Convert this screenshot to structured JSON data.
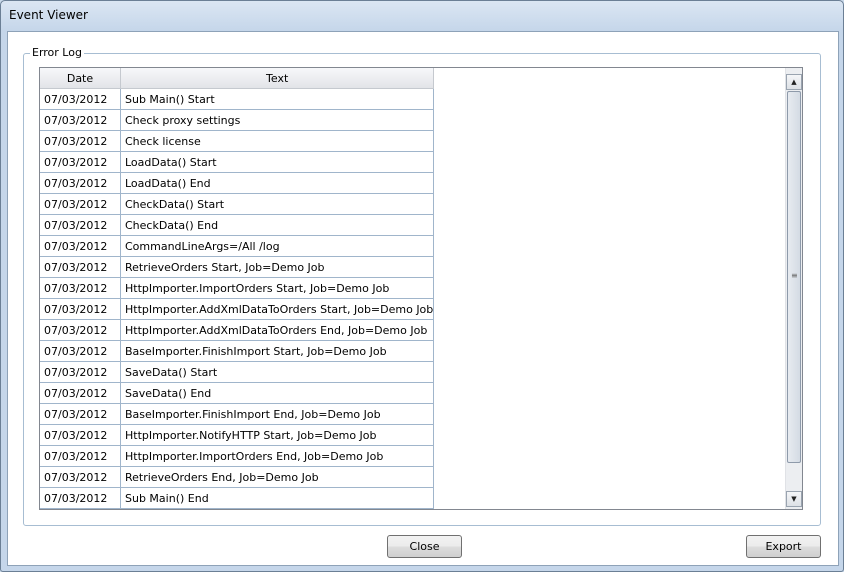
{
  "window": {
    "title": "Event Viewer"
  },
  "group": {
    "legend": "Error Log"
  },
  "table": {
    "columns": [
      "Date",
      "Text"
    ],
    "rows": [
      {
        "date": "07/03/2012",
        "text": "Sub Main() Start"
      },
      {
        "date": "07/03/2012",
        "text": "Check proxy settings"
      },
      {
        "date": "07/03/2012",
        "text": "Check license"
      },
      {
        "date": "07/03/2012",
        "text": "LoadData() Start"
      },
      {
        "date": "07/03/2012",
        "text": "LoadData() End"
      },
      {
        "date": "07/03/2012",
        "text": "CheckData() Start"
      },
      {
        "date": "07/03/2012",
        "text": "CheckData() End"
      },
      {
        "date": "07/03/2012",
        "text": "CommandLineArgs=/All /log"
      },
      {
        "date": "07/03/2012",
        "text": "RetrieveOrders Start, Job=Demo Job"
      },
      {
        "date": "07/03/2012",
        "text": "HttpImporter.ImportOrders Start, Job=Demo Job"
      },
      {
        "date": "07/03/2012",
        "text": "HttpImporter.AddXmlDataToOrders Start, Job=Demo Job"
      },
      {
        "date": "07/03/2012",
        "text": "HttpImporter.AddXmlDataToOrders End, Job=Demo Job"
      },
      {
        "date": "07/03/2012",
        "text": "BaseImporter.FinishImport Start, Job=Demo Job"
      },
      {
        "date": "07/03/2012",
        "text": "SaveData() Start"
      },
      {
        "date": "07/03/2012",
        "text": "SaveData() End"
      },
      {
        "date": "07/03/2012",
        "text": "BaseImporter.FinishImport End, Job=Demo Job"
      },
      {
        "date": "07/03/2012",
        "text": "HttpImporter.NotifyHTTP Start, Job=Demo Job"
      },
      {
        "date": "07/03/2012",
        "text": "HttpImporter.ImportOrders End, Job=Demo Job"
      },
      {
        "date": "07/03/2012",
        "text": "RetrieveOrders End, Job=Demo Job"
      },
      {
        "date": "07/03/2012",
        "text": "Sub Main() End"
      }
    ]
  },
  "buttons": {
    "close": "Close",
    "export": "Export"
  },
  "icons": {
    "scroll_up": "arrow-up-icon",
    "scroll_down": "arrow-down-icon",
    "grip": "scroll-grip-icon"
  }
}
